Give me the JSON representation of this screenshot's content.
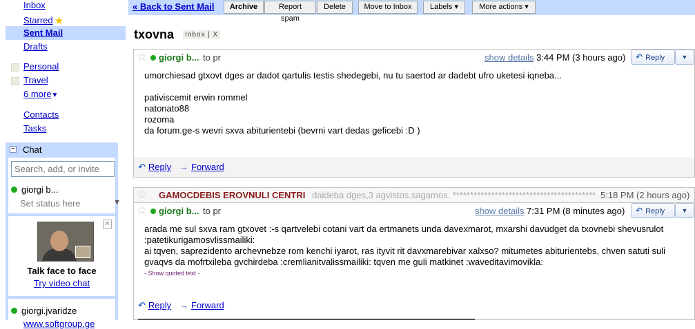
{
  "nav": {
    "inbox": "Inbox",
    "starred": "Starred",
    "sent_mail": "Sent Mail",
    "drafts": "Drafts",
    "labels": [
      "Personal",
      "Travel"
    ],
    "more": "6 more",
    "contacts": "Contacts",
    "tasks": "Tasks"
  },
  "chat": {
    "title": "Chat",
    "search_placeholder": "Search, add, or invite",
    "me_name": "giorgi b...",
    "status": "Set status here",
    "promo_title": "Talk face to face",
    "promo_link": "Try video chat",
    "contact_name": "giorgi.jvaridze",
    "contact_link": "www.softgroup.ge"
  },
  "toolbar": {
    "back": "« Back to Sent Mail",
    "archive": "Archive",
    "report_spam": "Report spam",
    "delete": "Delete",
    "move_to_inbox": "Move to Inbox",
    "labels": "Labels ▾",
    "more_actions": "More actions ▾"
  },
  "thread": {
    "subject": "txovna",
    "tag": "Inbox | X"
  },
  "messages": [
    {
      "sender": "giorgi b...",
      "to": "to pr",
      "show_details": "show details",
      "time": "3:44 PM (3 hours ago)",
      "reply": "Reply",
      "body_lines": [
        "umorchiesad gtxovt dges ar dadot qartulis testis shedegebi, nu tu saertod ar dadebt ufro uketesi iqneba...",
        "",
        "pativiscemit erwin rommel",
        "natonato88",
        "rozoma",
        "da forum.ge-s wevri sxva abiturientebi (bevrni vart dedas geficebi :D )"
      ],
      "foot_reply": "Reply",
      "foot_forward": "Forward"
    },
    {
      "sender": "giorgi b...",
      "to": "to pr",
      "show_details": "show details",
      "time": "7:31 PM (8 minutes ago)",
      "reply": "Reply",
      "body_lines": [
        "arada me sul sxva ram gtxovet :-s qartvelebi cotani vart da ertmanets unda davexmarot, mxarshi davudget da txovnebi shevusrulot :patetikurigamosvlissmailiki:",
        "ai tqven, saprezidento archevnebze rom kenchi iyarot, ras ityvit rit davxmarebivar xalxso? mitumetes abiturientebs, chven satuti suli gvaqvs da mofrtxileba gvchirdeba :cremlianitvalissmailiki: tqven me guli matkinet :waveditavimovikla:"
      ],
      "show_quoted": "- Show quoted text -",
      "foot_reply": "Reply",
      "foot_forward": "Forward"
    }
  ],
  "collapsed": {
    "sender": "GAMOCDEBIS EROVNULI CENTRI",
    "snippet": "daideba dges,3 agvistos.sagamos. ******************************************",
    "time": "5:18 PM (2 hours ago)"
  },
  "colors": {
    "nav_selected": "#c3d9ff",
    "toolbar_bg": "#c3d9ff",
    "link": "#0000cc",
    "online": "#1ea81e"
  }
}
